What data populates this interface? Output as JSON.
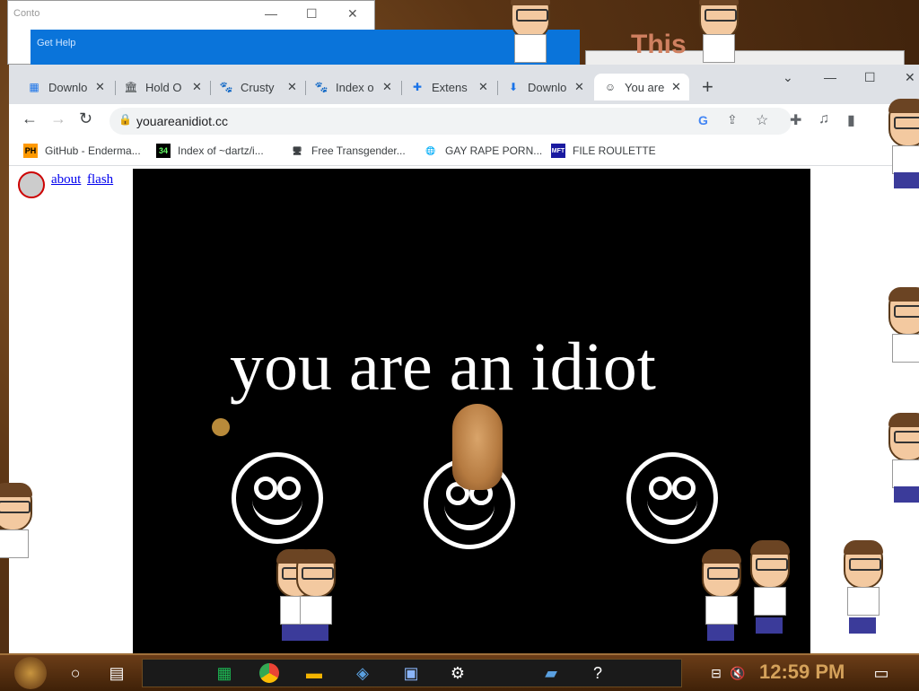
{
  "background_windows": {
    "left_title": "Conto",
    "mid_title": "Get Help",
    "right_text": "This"
  },
  "browser": {
    "tabs": [
      {
        "label": "Downlo",
        "icon": "download-page-icon"
      },
      {
        "label": "Hold O",
        "icon": "archive-icon"
      },
      {
        "label": "Crusty",
        "icon": "cat-favicon-icon"
      },
      {
        "label": "Index o",
        "icon": "cat-favicon-icon"
      },
      {
        "label": "Extens",
        "icon": "puzzle-icon"
      },
      {
        "label": "Downlo",
        "icon": "download-icon"
      },
      {
        "label": "You are",
        "icon": "smiley-icon",
        "active": true
      }
    ],
    "new_tab_label": "+",
    "address": "youareanidiot.cc",
    "bookmarks": [
      {
        "label": "GitHub - Enderma...",
        "icon": "ph-icon"
      },
      {
        "label": "Index of ~dartz/i...",
        "icon": "34-icon"
      },
      {
        "label": "Free Transgender...",
        "icon": "pc-icon"
      },
      {
        "label": "GAY RAPE PORN...",
        "icon": "globe-icon"
      },
      {
        "label": "FILE ROULETTE",
        "icon": "mft-icon"
      }
    ]
  },
  "page": {
    "links": [
      "about",
      "flash"
    ],
    "headline": "you are an idiot"
  },
  "taskbar": {
    "clock": "12:59 PM"
  }
}
